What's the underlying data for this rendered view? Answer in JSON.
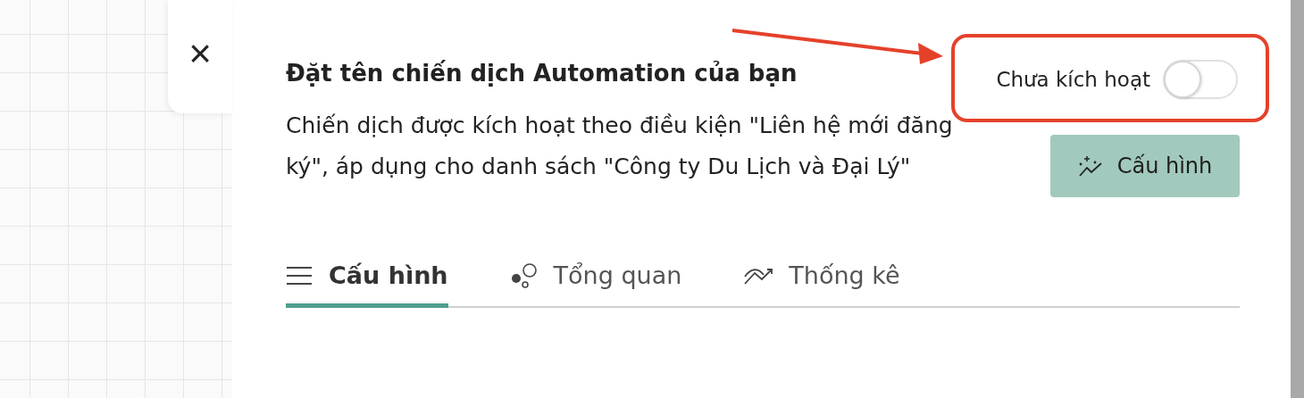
{
  "close_button": {
    "label": "×"
  },
  "campaign": {
    "title": "Đặt tên chiến dịch Automation của bạn",
    "description": "Chiến dịch được kích hoạt theo điều kiện \"Liên hệ mới đăng ký\", áp dụng cho danh sách \"Công ty Du Lịch và Đại Lý\""
  },
  "activation": {
    "label": "Chưa kích hoạt",
    "on": false
  },
  "configure_button": {
    "label": "Cấu hình"
  },
  "tabs": [
    {
      "label": "Cấu hình",
      "kind": "menu",
      "selected": true
    },
    {
      "label": "Tổng quan",
      "kind": "bubbles",
      "selected": false
    },
    {
      "label": "Thống kê",
      "kind": "trend",
      "selected": false
    }
  ]
}
